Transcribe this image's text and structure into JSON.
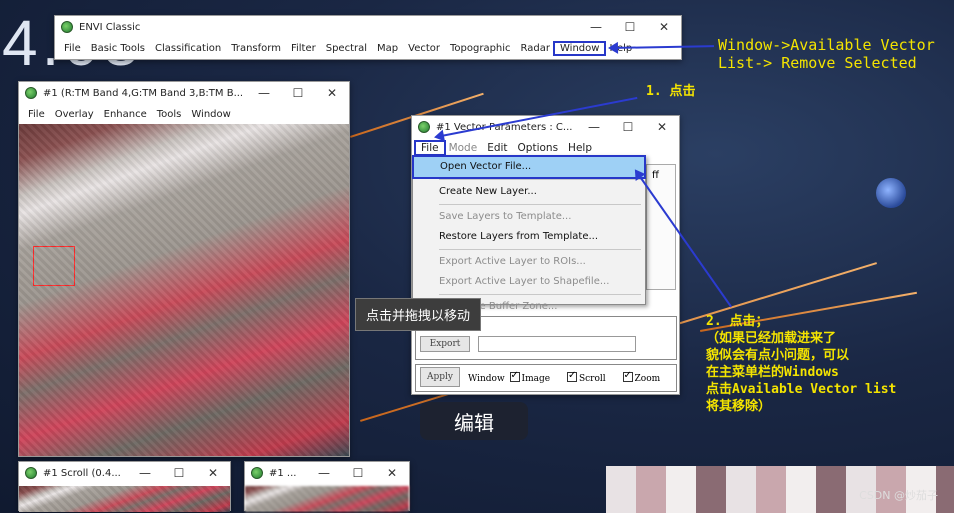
{
  "background": {
    "number": "4.03"
  },
  "envi_main": {
    "title": "ENVI Classic",
    "menu": [
      "File",
      "Basic Tools",
      "Classification",
      "Transform",
      "Filter",
      "Spectral",
      "Map",
      "Vector",
      "Topographic",
      "Radar",
      "Window",
      "Help"
    ]
  },
  "image_window": {
    "title": "#1 (R:TM Band 4,G:TM Band 3,B:TM B...",
    "menu": [
      "File",
      "Overlay",
      "Enhance",
      "Tools",
      "Window"
    ]
  },
  "vector_window": {
    "title": "#1 Vector Parameters : C...",
    "menu": [
      "File",
      "Mode",
      "Edit",
      "Options",
      "Help"
    ],
    "peek_text": "ff",
    "dropdown": [
      {
        "label": "Open Vector File...",
        "state": "selected"
      },
      {
        "sep": true
      },
      {
        "label": "Create New Layer...",
        "state": "normal"
      },
      {
        "sep": true
      },
      {
        "label": "Save Layers to Template...",
        "state": "disabled"
      },
      {
        "label": "Restore Layers from Template...",
        "state": "normal"
      },
      {
        "sep": true
      },
      {
        "label": "Export Active Layer to ROIs...",
        "state": "disabled"
      },
      {
        "label": "Export Active Layer to Shapefile...",
        "state": "disabled"
      },
      {
        "sep": true
      },
      {
        "label": "Calculate Buffer Zone...",
        "state": "disabled"
      }
    ],
    "export_label": "Export",
    "apply_label": "Apply",
    "window_label": "Window",
    "checks": [
      "Image",
      "Scroll",
      "Zoom"
    ]
  },
  "scroll_window": {
    "title": "#1 Scroll (0.4..."
  },
  "zoom_window": {
    "title": "#1 ..."
  },
  "tooltip": "点击并拖拽以移动",
  "edit_button": "编辑",
  "annotations": {
    "a1": "Window->Available Vector",
    "a2": "List-> Remove Selected",
    "b1": "1. 点击",
    "c": [
      "2. 点击；",
      "（如果已经加载进来了",
      "貌似会有点小问题，可以",
      "在主菜单栏的Windows",
      "点击Available Vector list",
      "将其移除）"
    ]
  },
  "watermark": "CSDN @炒茄子",
  "colors": {
    "annotation": "#f4e400",
    "highlight": "#2737c8"
  }
}
